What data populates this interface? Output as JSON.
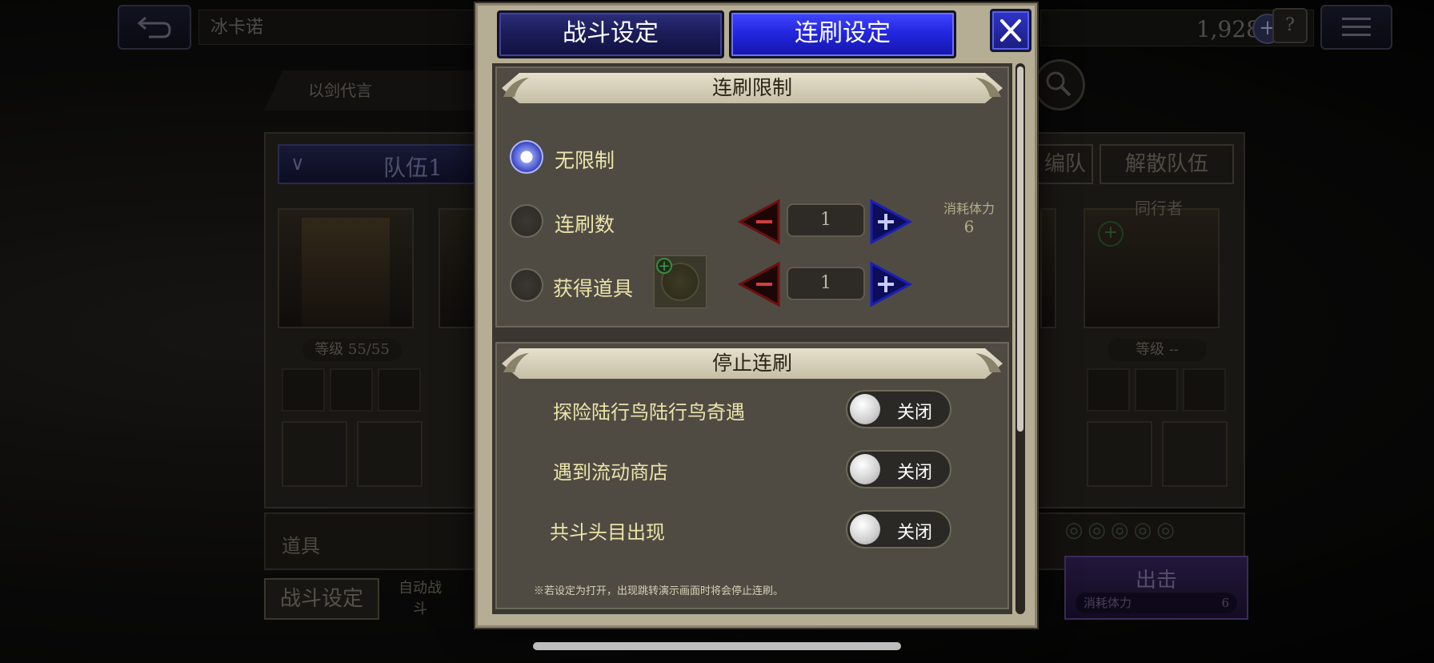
{
  "background": {
    "name_bar": "冰卡诺",
    "motto": "以剑代言",
    "gem_count": "1,928",
    "help": "?",
    "team_selector": "队伍1",
    "reorganize_button": "编队",
    "disband_button": "解散队伍",
    "companion_label": "同行者",
    "level_left": "等级 55/55",
    "level_right": "等级 --",
    "items_label": "道具",
    "battle_settings_button": "战斗设定",
    "auto_battle_label": "自动战斗",
    "sortie_button": "出击",
    "sortie_cost_label": "消耗体力",
    "sortie_cost_value": "6"
  },
  "modal": {
    "tabs": [
      {
        "label": "战斗设定",
        "active": false
      },
      {
        "label": "连刷设定",
        "active": true
      }
    ],
    "limit_section": {
      "title": "连刷限制",
      "options": [
        {
          "label": "无限制",
          "selected": true
        },
        {
          "label": "连刷数",
          "selected": false,
          "value": "1"
        },
        {
          "label": "获得道具",
          "selected": false,
          "value": "1"
        }
      ],
      "cost_label": "消耗体力",
      "cost_value": "6"
    },
    "stop_section": {
      "title": "停止连刷",
      "toggles": [
        {
          "label": "探险陆行鸟陆行鸟奇遇",
          "state": "关闭"
        },
        {
          "label": "遇到流动商店",
          "state": "关闭"
        },
        {
          "label": "共斗头目出现",
          "state": "关闭"
        }
      ],
      "note": "※若设定为打开，出现跳转演示画面时将会停止连刷。"
    }
  },
  "colors": {
    "active_tab": "#2327e0",
    "inactive_tab": "#1c1d5a",
    "label_text": "#ece3a9",
    "plus_arrow": "#1a1fb5",
    "minus_arrow": "#6b1010"
  }
}
